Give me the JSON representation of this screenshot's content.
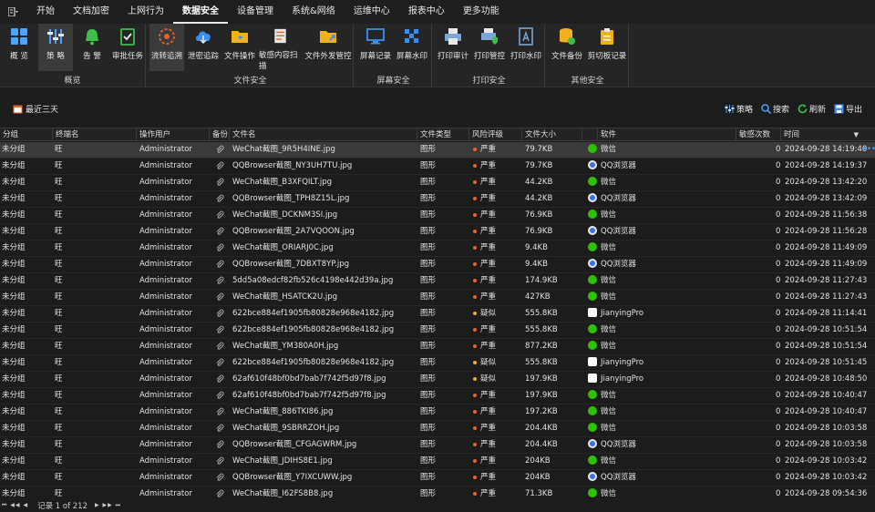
{
  "menubar": {
    "items": [
      "开始",
      "文档加密",
      "上网行为",
      "数据安全",
      "设备管理",
      "系统&网络",
      "运维中心",
      "报表中心",
      "更多功能"
    ],
    "active_index": 3
  },
  "ribbon": {
    "groups": [
      {
        "label": "概览",
        "buttons": [
          "概 览",
          "策 略",
          "告 警",
          "审批任务"
        ]
      },
      {
        "label": "文件安全",
        "buttons": [
          "流转追溯",
          "泄密追踪",
          "文件操作",
          "敏感内容扫描",
          "文件外发管控"
        ]
      },
      {
        "label": "屏幕安全",
        "buttons": [
          "屏幕记录",
          "屏幕水印"
        ]
      },
      {
        "label": "打印安全",
        "buttons": [
          "打印审计",
          "打印管控",
          "打印水印"
        ]
      },
      {
        "label": "其他安全",
        "buttons": [
          "文件备份",
          "剪切板记录"
        ]
      }
    ]
  },
  "toolbar": {
    "range_label": "最近三天",
    "strategy_label": "策略",
    "search_label": "搜索",
    "refresh_label": "刷新",
    "export_label": "导出"
  },
  "table": {
    "headers": [
      "分组",
      "终端名",
      "操作用户",
      "备份",
      "文件名",
      "文件类型",
      "风险评级",
      "文件大小",
      "软件",
      "敏感次数",
      "时间"
    ],
    "rows": [
      {
        "group": "未分组",
        "terminal": "旺",
        "user": "Administrator",
        "file": "WeChat截图_9R5H4INE.jpg",
        "type": "图形",
        "risk": "严重",
        "size": "79.7KB",
        "app": "微信",
        "app_kind": "wx",
        "count": "0",
        "time": "2024-09-28 14:19:40"
      },
      {
        "group": "未分组",
        "terminal": "旺",
        "user": "Administrator",
        "file": "QQBrowser截图_NY3UH7TU.jpg",
        "type": "图形",
        "risk": "严重",
        "size": "79.7KB",
        "app": "QQ浏览器",
        "app_kind": "qq",
        "count": "0",
        "time": "2024-09-28 14:19:37"
      },
      {
        "group": "未分组",
        "terminal": "旺",
        "user": "Administrator",
        "file": "WeChat截图_B3XFQILT.jpg",
        "type": "图形",
        "risk": "严重",
        "size": "44.2KB",
        "app": "微信",
        "app_kind": "wx",
        "count": "0",
        "time": "2024-09-28 13:42:20"
      },
      {
        "group": "未分组",
        "terminal": "旺",
        "user": "Administrator",
        "file": "QQBrowser截图_TPH8Z15L.jpg",
        "type": "图形",
        "risk": "严重",
        "size": "44.2KB",
        "app": "QQ浏览器",
        "app_kind": "qq",
        "count": "0",
        "time": "2024-09-28 13:42:09"
      },
      {
        "group": "未分组",
        "terminal": "旺",
        "user": "Administrator",
        "file": "WeChat截图_DCKNM3SI.jpg",
        "type": "图形",
        "risk": "严重",
        "size": "76.9KB",
        "app": "微信",
        "app_kind": "wx",
        "count": "0",
        "time": "2024-09-28 11:56:38"
      },
      {
        "group": "未分组",
        "terminal": "旺",
        "user": "Administrator",
        "file": "QQBrowser截图_2A7VQOON.jpg",
        "type": "图形",
        "risk": "严重",
        "size": "76.9KB",
        "app": "QQ浏览器",
        "app_kind": "qq",
        "count": "0",
        "time": "2024-09-28 11:56:28"
      },
      {
        "group": "未分组",
        "terminal": "旺",
        "user": "Administrator",
        "file": "WeChat截图_ORIARJ0C.jpg",
        "type": "图形",
        "risk": "严重",
        "size": "9.4KB",
        "app": "微信",
        "app_kind": "wx",
        "count": "0",
        "time": "2024-09-28 11:49:09"
      },
      {
        "group": "未分组",
        "terminal": "旺",
        "user": "Administrator",
        "file": "QQBrowser截图_7DBXT8YP.jpg",
        "type": "图形",
        "risk": "严重",
        "size": "9.4KB",
        "app": "QQ浏览器",
        "app_kind": "qq",
        "count": "0",
        "time": "2024-09-28 11:49:09"
      },
      {
        "group": "未分组",
        "terminal": "旺",
        "user": "Administrator",
        "file": "5dd5a08edcf82fb526c4198e442d39a.jpg",
        "type": "图形",
        "risk": "严重",
        "size": "174.9KB",
        "app": "微信",
        "app_kind": "wx",
        "count": "0",
        "time": "2024-09-28 11:27:43"
      },
      {
        "group": "未分组",
        "terminal": "旺",
        "user": "Administrator",
        "file": "WeChat截图_HSATCK2U.jpg",
        "type": "图形",
        "risk": "严重",
        "size": "427KB",
        "app": "微信",
        "app_kind": "wx",
        "count": "0",
        "time": "2024-09-28 11:27:43"
      },
      {
        "group": "未分组",
        "terminal": "旺",
        "user": "Administrator",
        "file": "622bce884ef1905fb80828e968e4182.jpg",
        "type": "图形",
        "risk": "疑似",
        "size": "555.8KB",
        "app": "JianyingPro",
        "app_kind": "jy",
        "count": "0",
        "time": "2024-09-28 11:14:41"
      },
      {
        "group": "未分组",
        "terminal": "旺",
        "user": "Administrator",
        "file": "622bce884ef1905fb80828e968e4182.jpg",
        "type": "图形",
        "risk": "严重",
        "size": "555.8KB",
        "app": "微信",
        "app_kind": "wx",
        "count": "0",
        "time": "2024-09-28 10:51:54"
      },
      {
        "group": "未分组",
        "terminal": "旺",
        "user": "Administrator",
        "file": "WeChat截图_YM380A0H.jpg",
        "type": "图形",
        "risk": "严重",
        "size": "877.2KB",
        "app": "微信",
        "app_kind": "wx",
        "count": "0",
        "time": "2024-09-28 10:51:54"
      },
      {
        "group": "未分组",
        "terminal": "旺",
        "user": "Administrator",
        "file": "622bce884ef1905fb80828e968e4182.jpg",
        "type": "图形",
        "risk": "疑似",
        "size": "555.8KB",
        "app": "JianyingPro",
        "app_kind": "jy",
        "count": "0",
        "time": "2024-09-28 10:51:45"
      },
      {
        "group": "未分组",
        "terminal": "旺",
        "user": "Administrator",
        "file": "62af610f48bf0bd7bab7f742f5d97f8.jpg",
        "type": "图形",
        "risk": "疑似",
        "size": "197.9KB",
        "app": "JianyingPro",
        "app_kind": "jy",
        "count": "0",
        "time": "2024-09-28 10:48:50"
      },
      {
        "group": "未分组",
        "terminal": "旺",
        "user": "Administrator",
        "file": "62af610f48bf0bd7bab7f742f5d97f8.jpg",
        "type": "图形",
        "risk": "严重",
        "size": "197.9KB",
        "app": "微信",
        "app_kind": "wx",
        "count": "0",
        "time": "2024-09-28 10:40:47"
      },
      {
        "group": "未分组",
        "terminal": "旺",
        "user": "Administrator",
        "file": "WeChat截图_886TKI86.jpg",
        "type": "图形",
        "risk": "严重",
        "size": "197.2KB",
        "app": "微信",
        "app_kind": "wx",
        "count": "0",
        "time": "2024-09-28 10:40:47"
      },
      {
        "group": "未分组",
        "terminal": "旺",
        "user": "Administrator",
        "file": "WeChat截图_9SBRRZOH.jpg",
        "type": "图形",
        "risk": "严重",
        "size": "204.4KB",
        "app": "微信",
        "app_kind": "wx",
        "count": "0",
        "time": "2024-09-28 10:03:58"
      },
      {
        "group": "未分组",
        "terminal": "旺",
        "user": "Administrator",
        "file": "QQBrowser截图_CFGAGWRM.jpg",
        "type": "图形",
        "risk": "严重",
        "size": "204.4KB",
        "app": "QQ浏览器",
        "app_kind": "qq",
        "count": "0",
        "time": "2024-09-28 10:03:58"
      },
      {
        "group": "未分组",
        "terminal": "旺",
        "user": "Administrator",
        "file": "WeChat截图_JDIHS8E1.jpg",
        "type": "图形",
        "risk": "严重",
        "size": "204KB",
        "app": "微信",
        "app_kind": "wx",
        "count": "0",
        "time": "2024-09-28 10:03:42"
      },
      {
        "group": "未分组",
        "terminal": "旺",
        "user": "Administrator",
        "file": "QQBrowser截图_Y7IXCUWW.jpg",
        "type": "图形",
        "risk": "严重",
        "size": "204KB",
        "app": "QQ浏览器",
        "app_kind": "qq",
        "count": "0",
        "time": "2024-09-28 10:03:42"
      },
      {
        "group": "未分组",
        "terminal": "旺",
        "user": "Administrator",
        "file": "WeChat截图_I62FS8B8.jpg",
        "type": "图形",
        "risk": "严重",
        "size": "71.3KB",
        "app": "微信",
        "app_kind": "wx",
        "count": "0",
        "time": "2024-09-28 09:54:36"
      }
    ],
    "selected_row": 0
  },
  "risk_colors": {
    "严重": "#e8622c",
    "疑似": "#f0b020"
  },
  "footer": {
    "record_label": "记录 1 of 212"
  }
}
